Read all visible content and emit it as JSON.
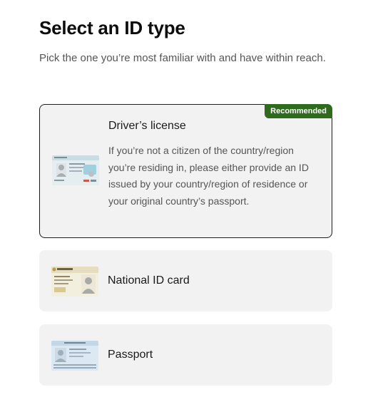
{
  "header": {
    "title": "Select an ID type",
    "subtitle": "Pick the one you’re most familiar with and have within reach."
  },
  "options": [
    {
      "title": "Driver’s license",
      "badge": "Recommended",
      "description": "If you’re not a citizen of the country/region you’re residing in, please either provide an ID issued by your country/region of residence or your original country’s passport.",
      "selected": true,
      "icon": "drivers-license-icon"
    },
    {
      "title": "National ID card",
      "icon": "national-id-card-icon"
    },
    {
      "title": "Passport",
      "icon": "passport-icon"
    }
  ],
  "colors": {
    "badge_bg": "#2e6b1c",
    "card_bg": "#f2f2f2",
    "selected_border": "#1c1c1c"
  }
}
